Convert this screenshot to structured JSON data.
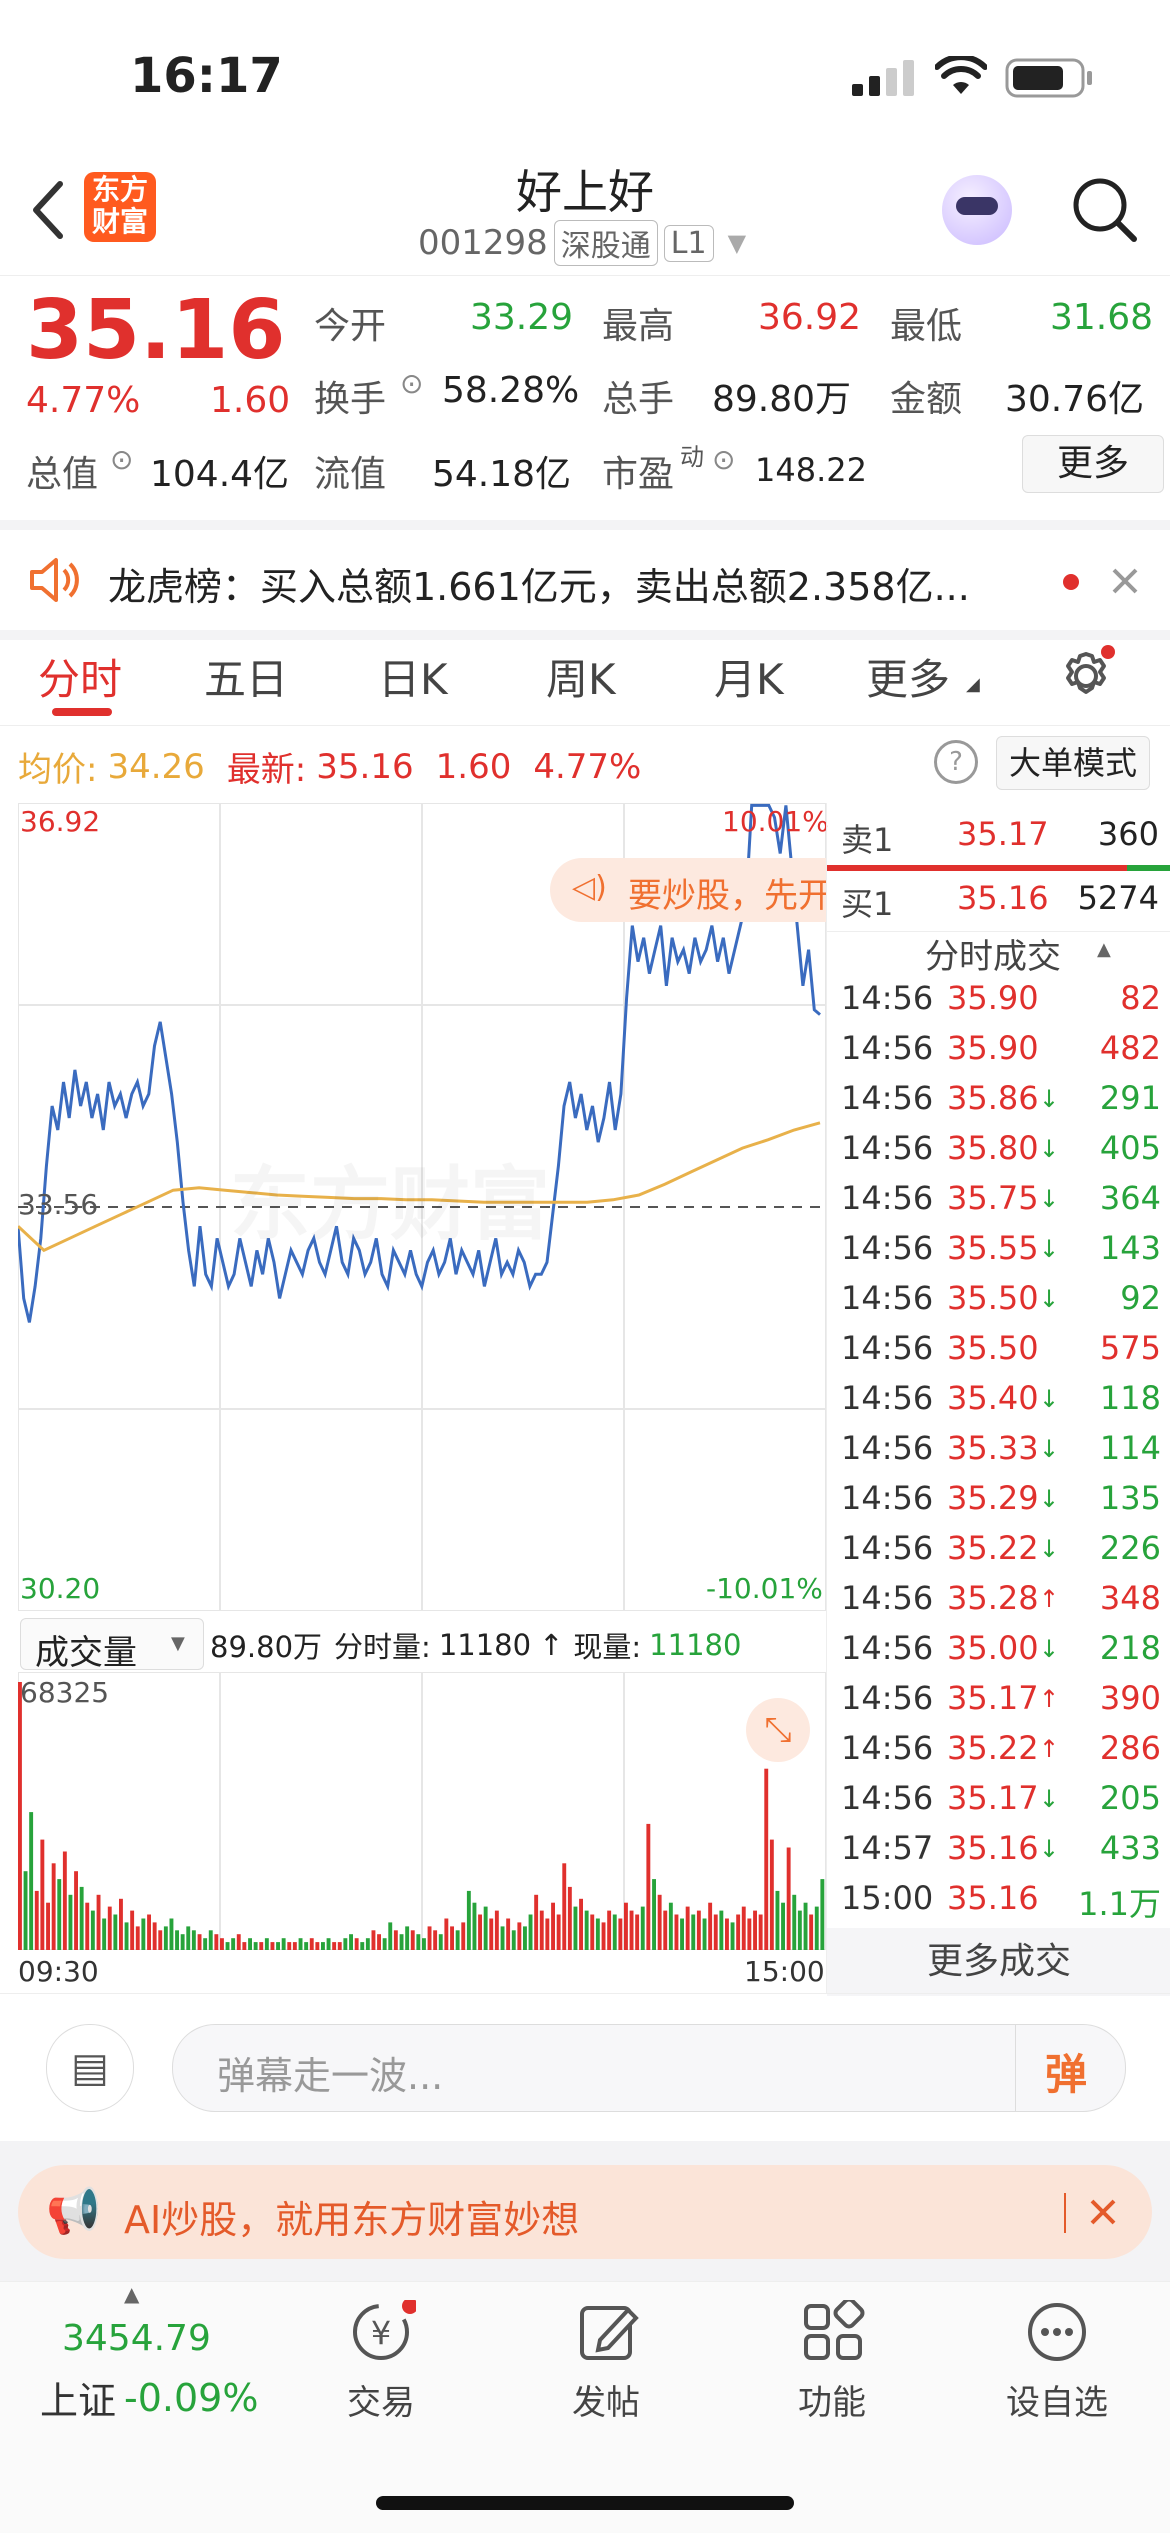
{
  "status_bar": {
    "time": "16:17"
  },
  "header": {
    "logo_text": "东方财富",
    "stock_name": "好上好",
    "stock_code": "001298",
    "tags": [
      "深股通",
      "L1"
    ]
  },
  "quote": {
    "price": "35.16",
    "change_pct": "4.77%",
    "change_amt": "1.60",
    "fields": {
      "open_label": "今开",
      "open": "33.29",
      "high_label": "最高",
      "high": "36.92",
      "low_label": "最低",
      "low": "31.68",
      "turnover_label": "换手",
      "turnover": "58.28%",
      "volume_label": "总手",
      "volume": "89.80万",
      "amount_label": "金额",
      "amount": "30.76亿",
      "mktcap_label": "总值",
      "mktcap": "104.4亿",
      "float_label": "流值",
      "float": "54.18亿",
      "pe_label": "市盈",
      "pe_sup": "动",
      "pe": "148.22"
    },
    "more_button": "更多"
  },
  "notice": {
    "text": "龙虎榜：买入总额1.661亿元，卖出总额2.358亿..."
  },
  "tabs": [
    "分时",
    "五日",
    "日K",
    "周K",
    "月K",
    "更多"
  ],
  "chart_header": {
    "avg_label": "均价:",
    "avg": "34.26",
    "latest_label": "最新:",
    "latest": "35.16",
    "chg": "1.60",
    "pct": "4.77%",
    "mode_button": "大单模式"
  },
  "overlay_promo": "要炒股，先开",
  "chart_data": {
    "type": "line",
    "y_max_label": "36.92",
    "y_min_label": "30.20",
    "pct_max_label": "10.01%",
    "pct_min_label": "-10.01%",
    "prev_close_label": "33.56",
    "ylim": [
      30.2,
      36.92
    ],
    "prev_close": 33.56,
    "x_start": "09:30",
    "x_end": "15:00",
    "series": [
      {
        "values": [
          33.4,
          32.8,
          32.6,
          32.9,
          33.3,
          33.9,
          34.4,
          34.2,
          34.6,
          34.3,
          34.7,
          34.4,
          34.6,
          34.3,
          34.5,
          34.2,
          34.6,
          34.4,
          34.5,
          34.3,
          34.5,
          34.6,
          34.4,
          34.5,
          34.9,
          35.1,
          34.8,
          34.5,
          34.1,
          33.6,
          33.2,
          32.9,
          33.4,
          33.0,
          32.9,
          33.3,
          33.1,
          32.9,
          33.0,
          33.3,
          33.1,
          32.9,
          33.2,
          33.0,
          33.3,
          33.1,
          32.8,
          33.0,
          33.2,
          33.1,
          33.0,
          33.2,
          33.3,
          33.1,
          33.0,
          33.2,
          33.4,
          33.1,
          33.0,
          33.3,
          33.2,
          33.0,
          33.1,
          33.3,
          33.0,
          32.9,
          33.2,
          33.1,
          33.0,
          33.2,
          33.0,
          32.9,
          33.1,
          33.2,
          33.0,
          33.1,
          33.3,
          33.0,
          33.2,
          33.1,
          33.0,
          33.2,
          32.9,
          33.1,
          33.3,
          33.0,
          33.1,
          33.0,
          33.2,
          33.1,
          32.9,
          33.0,
          33.0,
          33.1,
          33.5,
          33.9,
          34.4,
          34.6,
          34.3,
          34.5,
          34.2,
          34.4,
          34.1,
          34.3,
          34.6,
          34.2,
          34.5,
          35.3,
          35.9,
          35.6,
          35.8,
          35.5,
          35.7,
          35.9,
          35.4,
          35.8,
          35.6,
          35.7,
          35.5,
          35.8,
          35.6,
          35.7,
          35.9,
          35.6,
          35.8,
          35.5,
          35.7,
          35.9,
          36.1,
          36.9,
          36.9,
          36.9,
          36.9,
          36.8,
          36.5,
          36.9,
          36.4,
          35.9,
          35.4,
          35.7,
          35.2,
          35.16
        ],
        "avg": [
          33.4,
          33.2,
          33.3,
          33.4,
          33.5,
          33.6,
          33.7,
          33.72,
          33.7,
          33.68,
          33.66,
          33.65,
          33.64,
          33.63,
          33.63,
          33.62,
          33.62,
          33.61,
          33.6,
          33.6,
          33.6,
          33.6,
          33.6,
          33.62,
          33.66,
          33.75,
          33.85,
          33.95,
          34.05,
          34.12,
          34.2,
          34.26
        ]
      }
    ]
  },
  "volume": {
    "selector_label": "成交量",
    "total": "89.80万",
    "period_label": "分时量:",
    "period": "11180",
    "current_label": "现量:",
    "current": "11180",
    "max_label": "68325",
    "bars": [
      68,
      20,
      35,
      15,
      28,
      12,
      22,
      18,
      25,
      14,
      20,
      16,
      12,
      10,
      14,
      8,
      11,
      9,
      13,
      7,
      10,
      6,
      8,
      9,
      7,
      5,
      6,
      8,
      5,
      4,
      6,
      5,
      4,
      3,
      5,
      4,
      3,
      2,
      3,
      4,
      2,
      3,
      2,
      2,
      3,
      2,
      2,
      3,
      2,
      2,
      3,
      2,
      3,
      2,
      2,
      3,
      2,
      2,
      3,
      4,
      3,
      2,
      3,
      5,
      4,
      3,
      7,
      5,
      4,
      6,
      5,
      4,
      3,
      6,
      5,
      4,
      8,
      6,
      5,
      7,
      15,
      12,
      9,
      11,
      8,
      10,
      6,
      8,
      5,
      7,
      6,
      9,
      14,
      10,
      8,
      12,
      9,
      22,
      16,
      11,
      13,
      10,
      9,
      8,
      7,
      10,
      9,
      8,
      12,
      10,
      9,
      11,
      32,
      18,
      14,
      10,
      12,
      9,
      8,
      11,
      9,
      10,
      8,
      12,
      9,
      10,
      8,
      7,
      9,
      11,
      8,
      10,
      9,
      46,
      28,
      15,
      12,
      26,
      14,
      10,
      12,
      9,
      11,
      18
    ]
  },
  "orderbook": {
    "ask_label": "卖1",
    "ask_price": "35.17",
    "ask_vol": "360",
    "bid_label": "买1",
    "bid_price": "35.16",
    "bid_vol": "5274",
    "trades_title": "分时成交",
    "trades": [
      {
        "t": "14:56",
        "p": "35.90",
        "v": "82",
        "c": "red",
        "a": ""
      },
      {
        "t": "14:56",
        "p": "35.90",
        "v": "482",
        "c": "red",
        "a": ""
      },
      {
        "t": "14:56",
        "p": "35.86",
        "v": "291",
        "c": "green",
        "a": "↓"
      },
      {
        "t": "14:56",
        "p": "35.80",
        "v": "405",
        "c": "green",
        "a": "↓"
      },
      {
        "t": "14:56",
        "p": "35.75",
        "v": "364",
        "c": "green",
        "a": "↓"
      },
      {
        "t": "14:56",
        "p": "35.55",
        "v": "143",
        "c": "green",
        "a": "↓"
      },
      {
        "t": "14:56",
        "p": "35.50",
        "v": "92",
        "c": "green",
        "a": "↓"
      },
      {
        "t": "14:56",
        "p": "35.50",
        "v": "575",
        "c": "red",
        "a": ""
      },
      {
        "t": "14:56",
        "p": "35.40",
        "v": "118",
        "c": "green",
        "a": "↓"
      },
      {
        "t": "14:56",
        "p": "35.33",
        "v": "114",
        "c": "green",
        "a": "↓"
      },
      {
        "t": "14:56",
        "p": "35.29",
        "v": "135",
        "c": "green",
        "a": "↓"
      },
      {
        "t": "14:56",
        "p": "35.22",
        "v": "226",
        "c": "green",
        "a": "↓"
      },
      {
        "t": "14:56",
        "p": "35.28",
        "v": "348",
        "c": "red",
        "a": "↑"
      },
      {
        "t": "14:56",
        "p": "35.00",
        "v": "218",
        "c": "green",
        "a": "↓"
      },
      {
        "t": "14:56",
        "p": "35.17",
        "v": "390",
        "c": "red",
        "a": "↑"
      },
      {
        "t": "14:56",
        "p": "35.22",
        "v": "286",
        "c": "red",
        "a": "↑"
      },
      {
        "t": "14:56",
        "p": "35.17",
        "v": "205",
        "c": "green",
        "a": "↓"
      },
      {
        "t": "14:57",
        "p": "35.16",
        "v": "433",
        "c": "green",
        "a": "↓"
      },
      {
        "t": "15:00",
        "p": "35.16",
        "v": "1.1万",
        "c": "green",
        "a": ""
      }
    ],
    "more_trades": "更多成交"
  },
  "comment": {
    "placeholder": "弹幕走一波...",
    "send_label": "弹"
  },
  "ad": {
    "text": "AI炒股，就用东方财富妙想"
  },
  "bottom_nav": {
    "index_value": "3454.79",
    "index_name": "上证",
    "index_pct": "-0.09%",
    "items": [
      "交易",
      "发帖",
      "功能",
      "设自选"
    ]
  }
}
